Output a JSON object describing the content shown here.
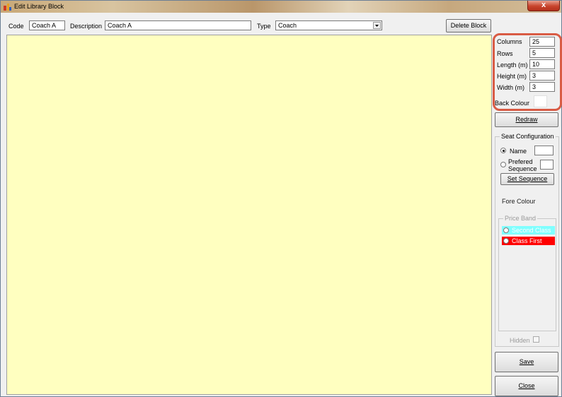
{
  "window": {
    "title": "Edit Library Block",
    "close_label": "x"
  },
  "header": {
    "code_label": "Code",
    "code_value": "Coach A",
    "description_label": "Description",
    "description_value": "Coach A",
    "type_label": "Type",
    "type_value": "Coach",
    "delete_button": "Delete Block"
  },
  "dimensions": {
    "columns_label": "Columns",
    "columns_value": "25",
    "rows_label": "Rows",
    "rows_value": "5",
    "length_label": "Length (m)",
    "length_value": "10",
    "height_label": "Height (m)",
    "height_value": "3",
    "width_label": "Width (m)",
    "width_value": "3",
    "back_colour_label": "Back Colour",
    "back_colour": "#ffffff"
  },
  "redraw_button": "Redraw",
  "seat_config": {
    "title": "Seat Configuration",
    "name_label": "Name",
    "prefered_label_1": "Prefered",
    "prefered_label_2": "Sequence",
    "set_sequence_button": "Set Sequence",
    "fore_colour_label": "Fore Colour",
    "price_band": {
      "title": "Price Band",
      "items": [
        {
          "label": "Second Class",
          "color": "#80ffff",
          "text_color": "#ffffff"
        },
        {
          "label": "Class First",
          "color": "#ff0000",
          "text_color": "#ffffff"
        }
      ]
    },
    "hidden_label": "Hidden"
  },
  "save_button": "Save",
  "close_button": "Close",
  "colors": {
    "canvas": "#ffffc0",
    "highlight": "#d95b44"
  }
}
